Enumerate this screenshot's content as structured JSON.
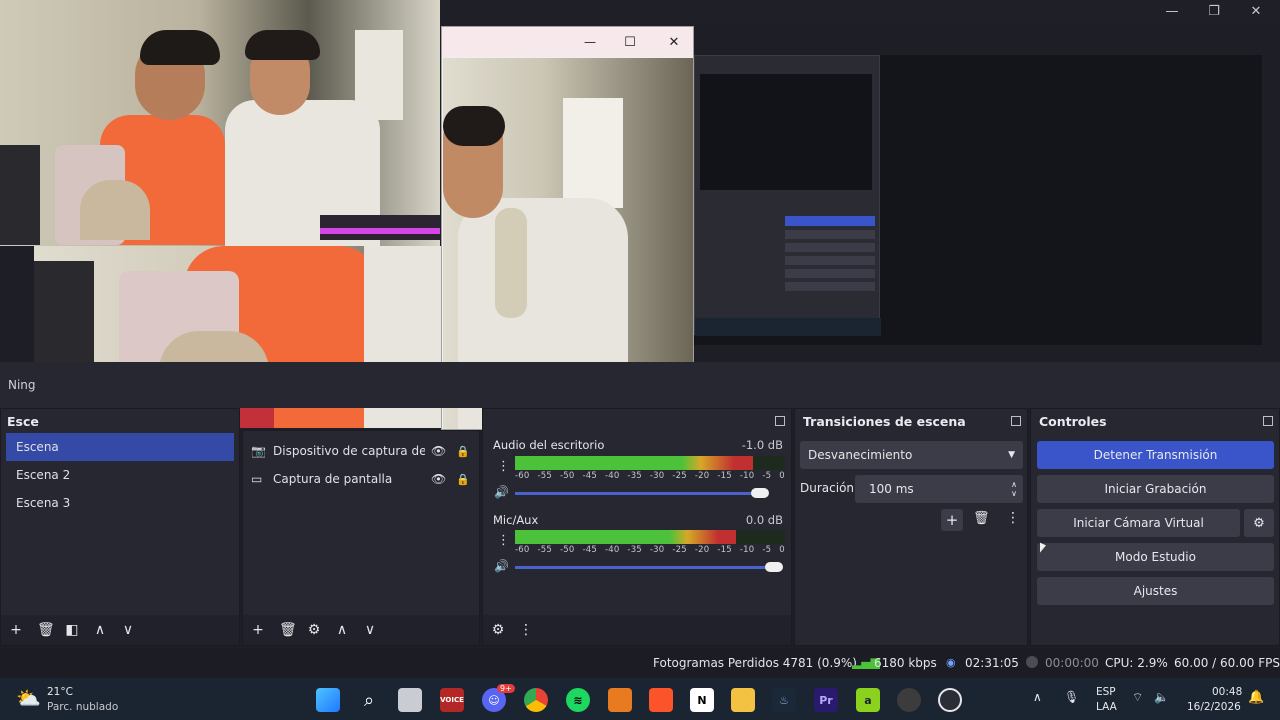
{
  "window": {
    "minimize_label": "—",
    "maximize_label": "❐",
    "close_label": "✕"
  },
  "camera_window": {
    "minimize_label": "—",
    "maximize_label": "☐",
    "close_label": "✕"
  },
  "scene_bar": {
    "no_source": "Ning"
  },
  "scenes_dock": {
    "title": "Esce",
    "items": [
      {
        "label": "Escena"
      },
      {
        "label": "Escena 2"
      },
      {
        "label": "Escena 3"
      }
    ]
  },
  "sources_dock": {
    "items": [
      {
        "label": "Dispositivo de captura de v"
      },
      {
        "label": "Captura de pantalla"
      }
    ]
  },
  "mixer": {
    "channels": [
      {
        "name": "Audio del escritorio",
        "db": "-1.0 dB",
        "level": 0.88
      },
      {
        "name": "Mic/Aux",
        "db": "0.0 dB",
        "level": 0.82
      }
    ],
    "ticks": [
      "-60",
      "-55",
      "-50",
      "-45",
      "-40",
      "-35",
      "-30",
      "-25",
      "-20",
      "-15",
      "-10",
      "-5",
      "0"
    ]
  },
  "transitions": {
    "title": "Transiciones de escena",
    "selected": "Desvanecimiento",
    "duration_label": "Duración",
    "duration_value": "100 ms"
  },
  "controls": {
    "title": "Controles",
    "stop_stream": "Detener Transmisión",
    "start_recording": "Iniciar Grabación",
    "start_virtual_cam": "Iniciar Cámara Virtual",
    "studio_mode": "Modo Estudio",
    "settings": "Ajustes"
  },
  "status": {
    "dropped_frames": "Fotogramas Perdidos 4781 (0.9%)",
    "bitrate": "6180 kbps",
    "stream_time": "02:31:05",
    "record_time": "00:00:00",
    "cpu": "CPU: 2.9%",
    "fps": "60.00 / 60.00 FPS"
  },
  "taskbar": {
    "weather_temp": "21°C",
    "weather_desc": "Parc. nublado",
    "lang_top": "ESP",
    "lang_bottom": "LAA",
    "time": "00:48",
    "date": "16/2/2026",
    "notif_badge": "9+"
  },
  "colors": {
    "accent": "#3a55c9",
    "meter_green": "#4cc23a",
    "meter_yellow": "#d6a827",
    "meter_red": "#c03030"
  }
}
